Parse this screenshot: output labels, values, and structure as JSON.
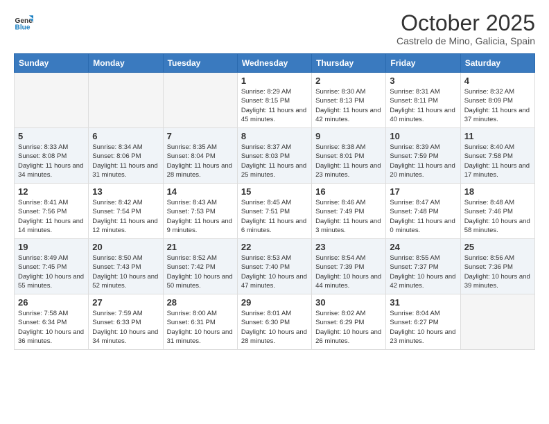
{
  "header": {
    "logo": {
      "general": "General",
      "blue": "Blue"
    },
    "title": "October 2025",
    "subtitle": "Castrelo de Mino, Galicia, Spain"
  },
  "weekdays": [
    "Sunday",
    "Monday",
    "Tuesday",
    "Wednesday",
    "Thursday",
    "Friday",
    "Saturday"
  ],
  "weeks": [
    [
      {
        "day": "",
        "info": ""
      },
      {
        "day": "",
        "info": ""
      },
      {
        "day": "",
        "info": ""
      },
      {
        "day": "1",
        "info": "Sunrise: 8:29 AM\nSunset: 8:15 PM\nDaylight: 11 hours\nand 45 minutes."
      },
      {
        "day": "2",
        "info": "Sunrise: 8:30 AM\nSunset: 8:13 PM\nDaylight: 11 hours\nand 42 minutes."
      },
      {
        "day": "3",
        "info": "Sunrise: 8:31 AM\nSunset: 8:11 PM\nDaylight: 11 hours\nand 40 minutes."
      },
      {
        "day": "4",
        "info": "Sunrise: 8:32 AM\nSunset: 8:09 PM\nDaylight: 11 hours\nand 37 minutes."
      }
    ],
    [
      {
        "day": "5",
        "info": "Sunrise: 8:33 AM\nSunset: 8:08 PM\nDaylight: 11 hours\nand 34 minutes."
      },
      {
        "day": "6",
        "info": "Sunrise: 8:34 AM\nSunset: 8:06 PM\nDaylight: 11 hours\nand 31 minutes."
      },
      {
        "day": "7",
        "info": "Sunrise: 8:35 AM\nSunset: 8:04 PM\nDaylight: 11 hours\nand 28 minutes."
      },
      {
        "day": "8",
        "info": "Sunrise: 8:37 AM\nSunset: 8:03 PM\nDaylight: 11 hours\nand 25 minutes."
      },
      {
        "day": "9",
        "info": "Sunrise: 8:38 AM\nSunset: 8:01 PM\nDaylight: 11 hours\nand 23 minutes."
      },
      {
        "day": "10",
        "info": "Sunrise: 8:39 AM\nSunset: 7:59 PM\nDaylight: 11 hours\nand 20 minutes."
      },
      {
        "day": "11",
        "info": "Sunrise: 8:40 AM\nSunset: 7:58 PM\nDaylight: 11 hours\nand 17 minutes."
      }
    ],
    [
      {
        "day": "12",
        "info": "Sunrise: 8:41 AM\nSunset: 7:56 PM\nDaylight: 11 hours\nand 14 minutes."
      },
      {
        "day": "13",
        "info": "Sunrise: 8:42 AM\nSunset: 7:54 PM\nDaylight: 11 hours\nand 12 minutes."
      },
      {
        "day": "14",
        "info": "Sunrise: 8:43 AM\nSunset: 7:53 PM\nDaylight: 11 hours\nand 9 minutes."
      },
      {
        "day": "15",
        "info": "Sunrise: 8:45 AM\nSunset: 7:51 PM\nDaylight: 11 hours\nand 6 minutes."
      },
      {
        "day": "16",
        "info": "Sunrise: 8:46 AM\nSunset: 7:49 PM\nDaylight: 11 hours\nand 3 minutes."
      },
      {
        "day": "17",
        "info": "Sunrise: 8:47 AM\nSunset: 7:48 PM\nDaylight: 11 hours\nand 0 minutes."
      },
      {
        "day": "18",
        "info": "Sunrise: 8:48 AM\nSunset: 7:46 PM\nDaylight: 10 hours\nand 58 minutes."
      }
    ],
    [
      {
        "day": "19",
        "info": "Sunrise: 8:49 AM\nSunset: 7:45 PM\nDaylight: 10 hours\nand 55 minutes."
      },
      {
        "day": "20",
        "info": "Sunrise: 8:50 AM\nSunset: 7:43 PM\nDaylight: 10 hours\nand 52 minutes."
      },
      {
        "day": "21",
        "info": "Sunrise: 8:52 AM\nSunset: 7:42 PM\nDaylight: 10 hours\nand 50 minutes."
      },
      {
        "day": "22",
        "info": "Sunrise: 8:53 AM\nSunset: 7:40 PM\nDaylight: 10 hours\nand 47 minutes."
      },
      {
        "day": "23",
        "info": "Sunrise: 8:54 AM\nSunset: 7:39 PM\nDaylight: 10 hours\nand 44 minutes."
      },
      {
        "day": "24",
        "info": "Sunrise: 8:55 AM\nSunset: 7:37 PM\nDaylight: 10 hours\nand 42 minutes."
      },
      {
        "day": "25",
        "info": "Sunrise: 8:56 AM\nSunset: 7:36 PM\nDaylight: 10 hours\nand 39 minutes."
      }
    ],
    [
      {
        "day": "26",
        "info": "Sunrise: 7:58 AM\nSunset: 6:34 PM\nDaylight: 10 hours\nand 36 minutes."
      },
      {
        "day": "27",
        "info": "Sunrise: 7:59 AM\nSunset: 6:33 PM\nDaylight: 10 hours\nand 34 minutes."
      },
      {
        "day": "28",
        "info": "Sunrise: 8:00 AM\nSunset: 6:31 PM\nDaylight: 10 hours\nand 31 minutes."
      },
      {
        "day": "29",
        "info": "Sunrise: 8:01 AM\nSunset: 6:30 PM\nDaylight: 10 hours\nand 28 minutes."
      },
      {
        "day": "30",
        "info": "Sunrise: 8:02 AM\nSunset: 6:29 PM\nDaylight: 10 hours\nand 26 minutes."
      },
      {
        "day": "31",
        "info": "Sunrise: 8:04 AM\nSunset: 6:27 PM\nDaylight: 10 hours\nand 23 minutes."
      },
      {
        "day": "",
        "info": ""
      }
    ]
  ]
}
